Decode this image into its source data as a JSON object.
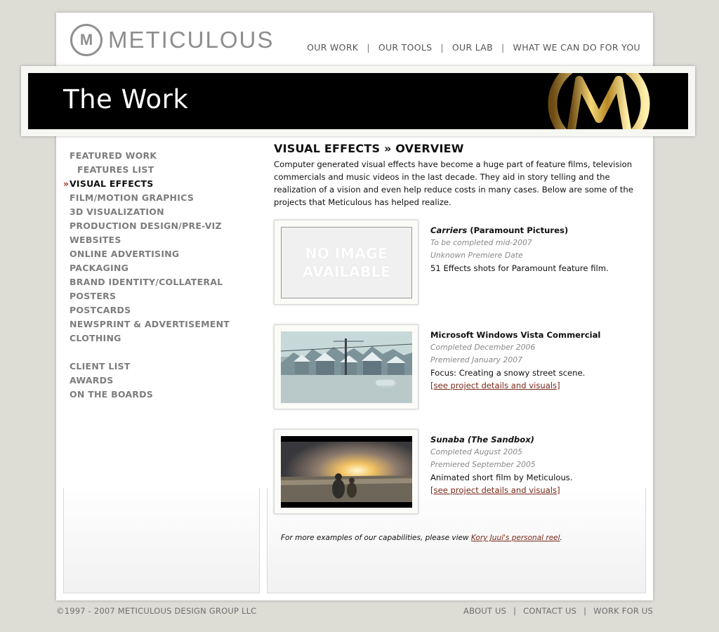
{
  "header": {
    "logo_mark": "M",
    "logo_text": "METICULOUS",
    "nav": [
      "OUR WORK",
      "OUR TOOLS",
      "OUR LAB",
      "WHAT WE CAN DO FOR YOU"
    ],
    "separator": "|"
  },
  "banner": {
    "title": "The Work"
  },
  "sidebar": {
    "items": [
      "FEATURED WORK",
      "FEATURES LIST",
      "VISUAL EFFECTS",
      "FILM/MOTION GRAPHICS",
      "3D VISUALIZATION",
      "PRODUCTION DESIGN/PRE-VIZ",
      "WEBSITES",
      "ONLINE ADVERTISING",
      "PACKAGING",
      "BRAND IDENTITY/COLLATERAL",
      "POSTERS",
      "POSTCARDS",
      "NEWSPRINT & ADVERTISEMENT",
      "CLOTHING",
      "CLIENT LIST",
      "AWARDS",
      "ON THE BOARDS"
    ]
  },
  "main": {
    "heading": "VISUAL EFFECTS » OVERVIEW",
    "intro": "Computer generated visual effects have become a huge part of feature films, television commercials and music videos in the last decade. They aid in story telling and the realization of a vision and even help reduce costs in many cases. Below are some of the projects that Meticulous has helped realize.",
    "projects": [
      {
        "thumb_placeholder": "NO IMAGE AVAILABLE",
        "title_italic": "Carriers",
        "title_rest": " (Paramount Pictures)",
        "line1": "To be completed mid-2007",
        "line2": "Unknown Premiere Date",
        "desc": "51 Effects shots for Paramount feature film.",
        "link": ""
      },
      {
        "title_italic": "",
        "title_rest": "Microsoft Windows Vista Commercial",
        "line1": "Completed December 2006",
        "line2": "Premiered January 2007",
        "desc": "Focus: Creating a snowy street scene.",
        "link": "[see project details and visuals]"
      },
      {
        "title_italic": "Sunaba (The Sandbox)",
        "title_rest": "",
        "line1": "Completed August 2005",
        "line2": "Premiered September 2005",
        "desc": "Animated short film by Meticulous.",
        "link": "[see project details and visuals]"
      }
    ],
    "more_prefix": "For more examples of our capabilities, please view ",
    "more_link": "Kory Juul's personal reel",
    "more_suffix": "."
  },
  "footer": {
    "copyright": "©1997 - 2007 METICULOUS DESIGN GROUP LLC",
    "links": [
      "ABOUT US",
      "CONTACT US",
      "WORK FOR US"
    ],
    "separator": "|"
  },
  "colors": {
    "background": "#dddcd5",
    "accent_link": "#7a2a1c",
    "banner": "#000000",
    "gold": "#d7b44c"
  }
}
